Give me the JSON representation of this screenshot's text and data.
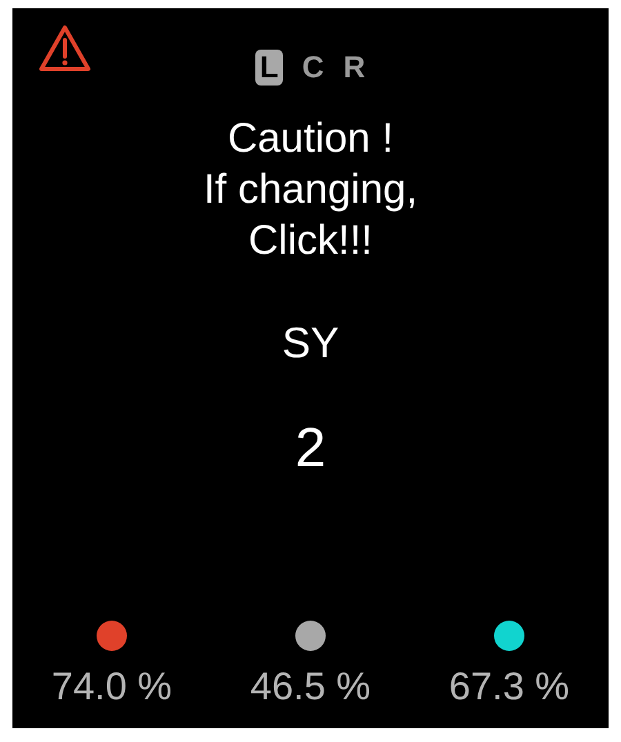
{
  "channels": [
    {
      "label": "L",
      "selected": true
    },
    {
      "label": "C",
      "selected": false
    },
    {
      "label": "R",
      "selected": false
    }
  ],
  "warning": true,
  "message": [
    "Caution !",
    "If changing,",
    "Click!!!"
  ],
  "parameter": "SY",
  "value": "2",
  "readings": [
    {
      "color": "#e0412a",
      "reading": "74.0 %"
    },
    {
      "color": "#a8a8a8",
      "reading": "46.5 %"
    },
    {
      "color": "#11d4cf",
      "reading": "67.3 %"
    }
  ]
}
